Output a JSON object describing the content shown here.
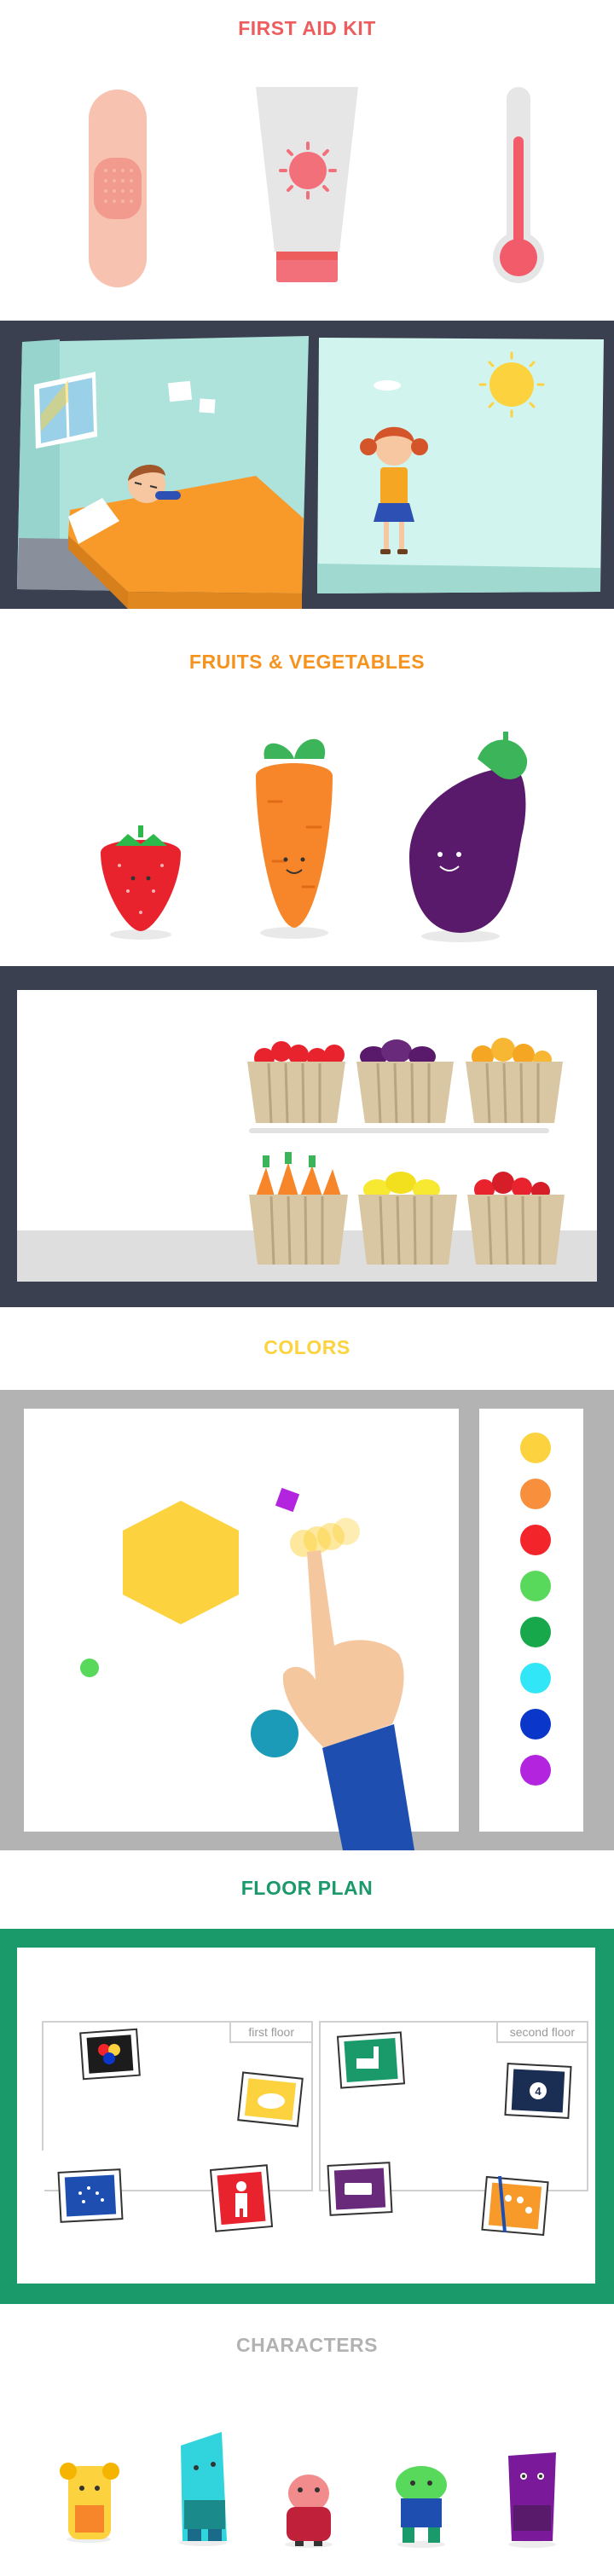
{
  "sections": {
    "first_aid": {
      "title": "FIRST AID KIT",
      "color": "#ee5d5d"
    },
    "fruits": {
      "title": "FRUITS & VEGETABLES",
      "color": "#f5931e"
    },
    "colors": {
      "title": "COLORS",
      "color": "#fcd23e",
      "palette": [
        "#fcd23e",
        "#f78f3c",
        "#f3242a",
        "#58d95b",
        "#17a84b",
        "#31e6f7",
        "#0a36c9",
        "#b224de"
      ]
    },
    "floor_plan": {
      "title": "FLOOR PLAN",
      "color": "#1a9a6a",
      "first_floor_label": "first floor",
      "second_floor_label": "second floor",
      "room_icons": [
        "color-picture-icon",
        "animal-picture-icon",
        "bath-picture-icon",
        "numbers-picture-icon",
        "dots-picture-icon",
        "person-picture-icon",
        "vehicle-picture-icon",
        "paint-picture-icon"
      ]
    },
    "characters": {
      "title": "CHARACTERS",
      "color": "#b2b2b2"
    }
  },
  "colors_theme": {
    "frame_dark": "#3b4050",
    "frame_gray": "#b3b3b3",
    "floor_green": "#1a9a6a"
  }
}
